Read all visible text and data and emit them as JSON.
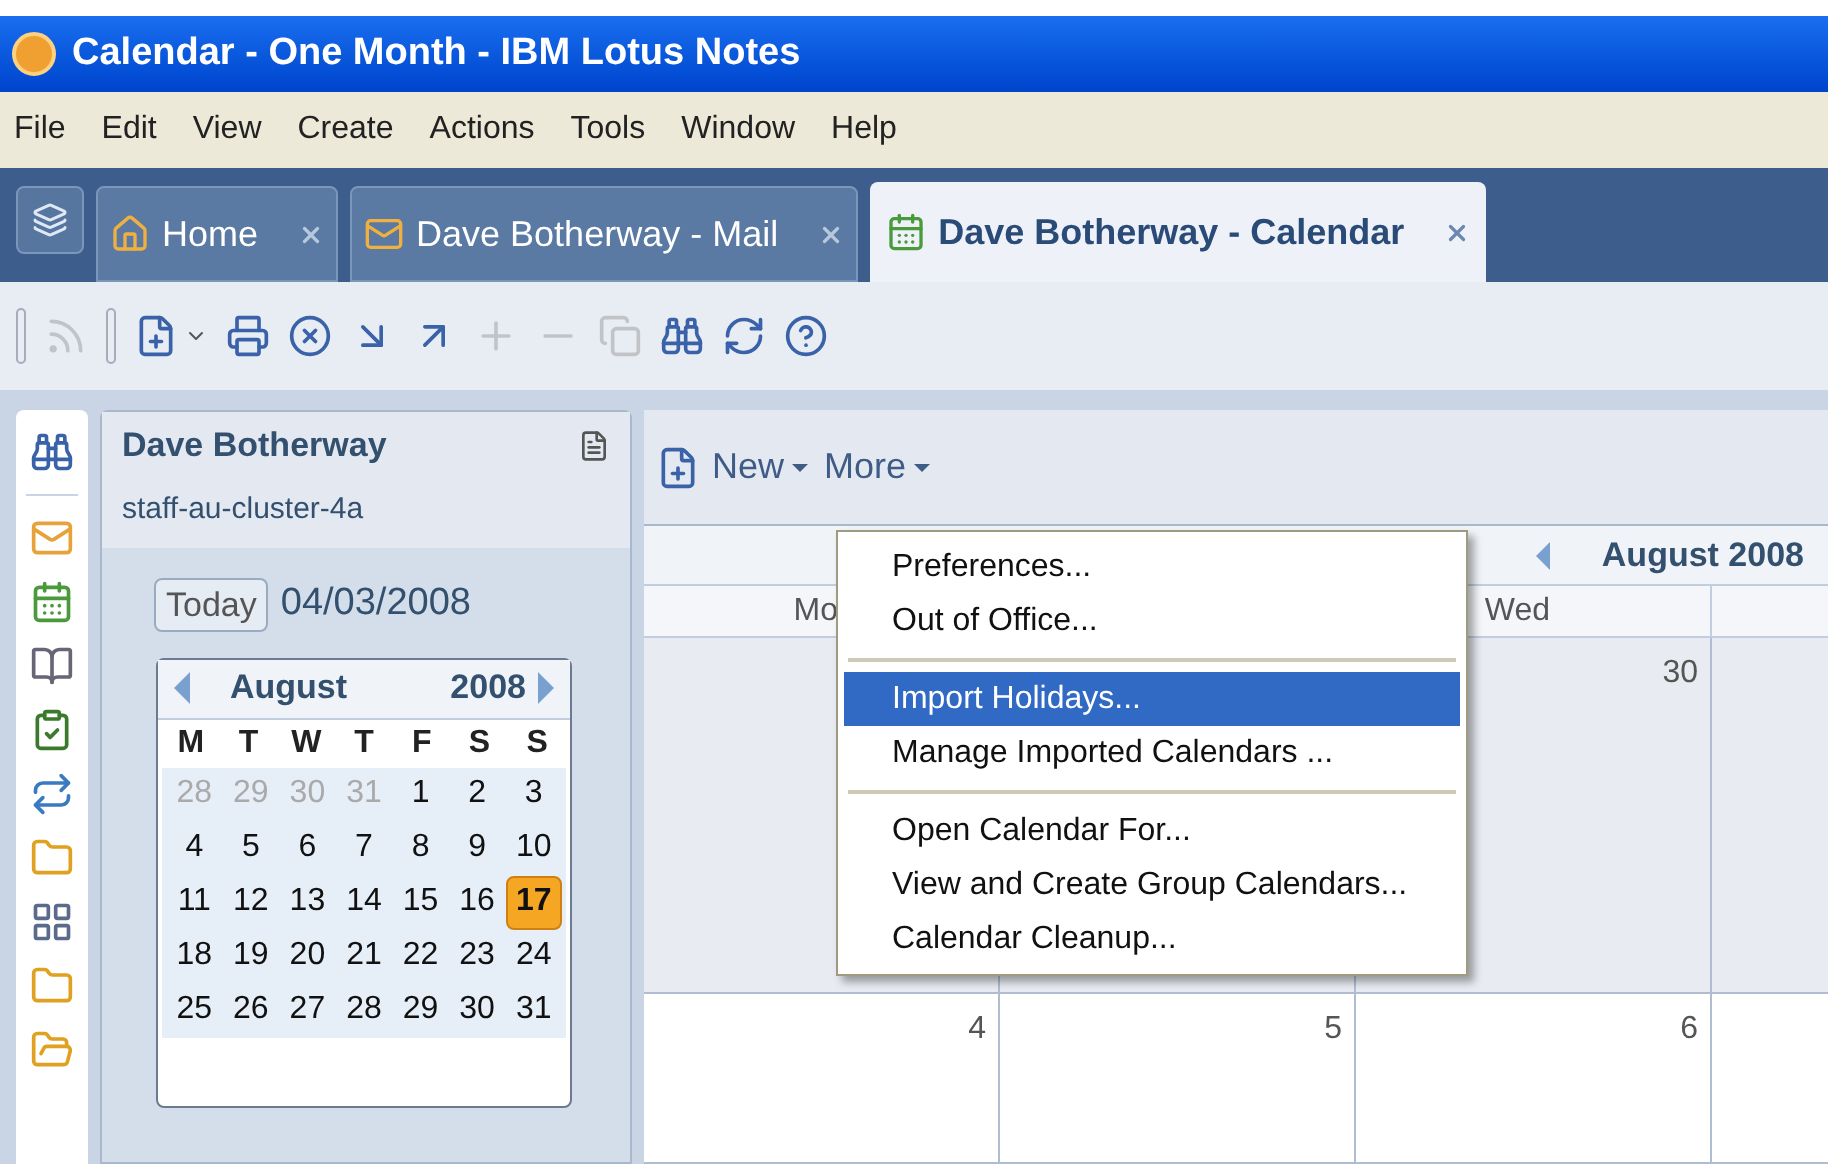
{
  "window": {
    "title": "Calendar - One Month - IBM Lotus Notes"
  },
  "menu_bar": [
    "File",
    "Edit",
    "View",
    "Create",
    "Actions",
    "Tools",
    "Window",
    "Help"
  ],
  "tabs": [
    {
      "label": "Home",
      "selected": false
    },
    {
      "label": "Dave Botherway - Mail",
      "selected": false
    },
    {
      "label": "Dave Botherway - Calendar",
      "selected": true
    }
  ],
  "toolbar": [
    {
      "disabled": true
    },
    {
      "disabled": false
    },
    {
      "disabled": false
    },
    {
      "disabled": false
    },
    {
      "disabled": false
    },
    {
      "disabled": false
    },
    {
      "disabled": true
    },
    {
      "disabled": true
    },
    {
      "disabled": true
    },
    {
      "disabled": false
    },
    {
      "disabled": false
    },
    {
      "disabled": false
    }
  ],
  "nav_panel": {
    "title": "Dave Botherway",
    "server": "staff-au-cluster-4a",
    "today_button": "Today",
    "date": "04/03/2008",
    "mini_calendar": {
      "month": "August",
      "year": "2008",
      "weekdays": [
        "M",
        "T",
        "W",
        "T",
        "F",
        "S",
        "S"
      ],
      "weeks": [
        [
          {
            "day": "28",
            "muted": true,
            "selected": false
          },
          {
            "day": "29",
            "muted": true,
            "selected": false
          },
          {
            "day": "30",
            "muted": true,
            "selected": false
          },
          {
            "day": "31",
            "muted": true,
            "selected": false
          },
          {
            "day": "1",
            "muted": false,
            "selected": false
          },
          {
            "day": "2",
            "muted": false,
            "selected": false
          },
          {
            "day": "3",
            "muted": false,
            "selected": false
          }
        ],
        [
          {
            "day": "4",
            "muted": false,
            "selected": false
          },
          {
            "day": "5",
            "muted": false,
            "selected": false
          },
          {
            "day": "6",
            "muted": false,
            "selected": false
          },
          {
            "day": "7",
            "muted": false,
            "selected": false
          },
          {
            "day": "8",
            "muted": false,
            "selected": false
          },
          {
            "day": "9",
            "muted": false,
            "selected": false
          },
          {
            "day": "10",
            "muted": false,
            "selected": false
          }
        ],
        [
          {
            "day": "11",
            "muted": false,
            "selected": false
          },
          {
            "day": "12",
            "muted": false,
            "selected": false
          },
          {
            "day": "13",
            "muted": false,
            "selected": false
          },
          {
            "day": "14",
            "muted": false,
            "selected": false
          },
          {
            "day": "15",
            "muted": false,
            "selected": false
          },
          {
            "day": "16",
            "muted": false,
            "selected": false
          },
          {
            "day": "17",
            "muted": false,
            "selected": true
          }
        ],
        [
          {
            "day": "18",
            "muted": false,
            "selected": false
          },
          {
            "day": "19",
            "muted": false,
            "selected": false
          },
          {
            "day": "20",
            "muted": false,
            "selected": false
          },
          {
            "day": "21",
            "muted": false,
            "selected": false
          },
          {
            "day": "22",
            "muted": false,
            "selected": false
          },
          {
            "day": "23",
            "muted": false,
            "selected": false
          },
          {
            "day": "24",
            "muted": false,
            "selected": false
          }
        ],
        [
          {
            "day": "25",
            "muted": false,
            "selected": false
          },
          {
            "day": "26",
            "muted": false,
            "selected": false
          },
          {
            "day": "27",
            "muted": false,
            "selected": false
          },
          {
            "day": "28",
            "muted": false,
            "selected": false
          },
          {
            "day": "29",
            "muted": false,
            "selected": false
          },
          {
            "day": "30",
            "muted": false,
            "selected": false
          },
          {
            "day": "31",
            "muted": false,
            "selected": false
          }
        ]
      ]
    }
  },
  "calendar": {
    "actions": [
      "New",
      "More"
    ],
    "period": "August 2008",
    "day_headers": {
      "monday": "Mo",
      "wednesday": "Wed"
    },
    "weeks": [
      [
        {
          "muted": true
        },
        {
          "muted": true
        },
        {
          "muted": true,
          "day": "30"
        },
        {
          "muted": true
        }
      ],
      [
        {
          "muted": false,
          "day": "4"
        },
        {
          "muted": false,
          "day": "5"
        },
        {
          "muted": false,
          "day": "6"
        },
        {
          "muted": false
        }
      ]
    ]
  },
  "dropdown_menu": [
    {
      "kind": "item",
      "label": "Preferences...",
      "selected": false
    },
    {
      "kind": "item",
      "label": "Out of Office...",
      "selected": false
    },
    {
      "kind": "separator"
    },
    {
      "kind": "item",
      "label": "Import Holidays...",
      "selected": true
    },
    {
      "kind": "item",
      "label": "Manage Imported Calendars ...",
      "selected": false
    },
    {
      "kind": "separator"
    },
    {
      "kind": "item",
      "label": "Open Calendar For...",
      "selected": false
    },
    {
      "kind": "item",
      "label": "View and Create Group Calendars...",
      "selected": false
    },
    {
      "kind": "item",
      "label": "Calendar Cleanup...",
      "selected": false
    }
  ]
}
